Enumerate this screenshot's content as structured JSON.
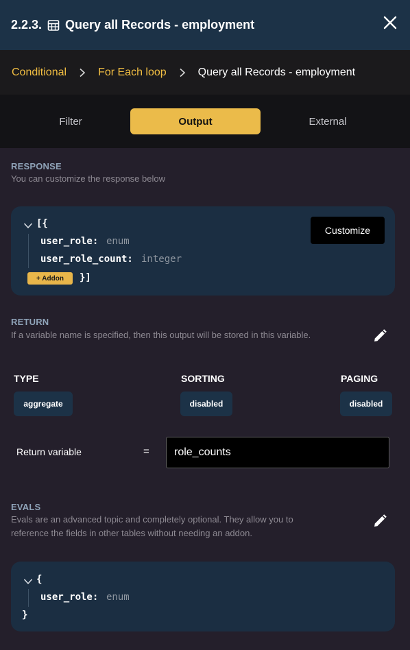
{
  "header": {
    "number": "2.2.3.",
    "title": "Query all Records - employment"
  },
  "breadcrumb": {
    "items": [
      "Conditional",
      "For Each loop"
    ],
    "current": "Query all Records - employment"
  },
  "tabs": [
    {
      "label": "Filter",
      "active": false
    },
    {
      "label": "Output",
      "active": true
    },
    {
      "label": "External",
      "active": false
    }
  ],
  "response": {
    "title": "RESPONSE",
    "description": "You can customize the response below",
    "open": "[{",
    "close": "}]",
    "fields": [
      {
        "key": "user_role:",
        "type": "enum"
      },
      {
        "key": "user_role_count:",
        "type": "integer"
      }
    ],
    "addon_label": "+ Addon",
    "customize_label": "Customize"
  },
  "return": {
    "title": "RETURN",
    "description": "If a variable name is specified, then this output will be stored in this variable.",
    "columns": [
      {
        "label": "TYPE",
        "value": "aggregate"
      },
      {
        "label": "SORTING",
        "value": "disabled"
      },
      {
        "label": "PAGING",
        "value": "disabled"
      }
    ],
    "variable_label": "Return variable",
    "equals": "=",
    "variable_value": "role_counts"
  },
  "evals": {
    "title": "EVALS",
    "description_line1": "Evals are an advanced topic and completely optional. They allow you to",
    "description_line2": "reference the fields in other tables without needing an addon.",
    "open": "{",
    "close": "}",
    "fields": [
      {
        "key": "user_role:",
        "type": "enum"
      }
    ]
  },
  "colors": {
    "accent": "#ebbb4a",
    "header_bg": "#1c3247",
    "panel_bg": "#241f2b",
    "code_bg": "#1b2e42"
  }
}
